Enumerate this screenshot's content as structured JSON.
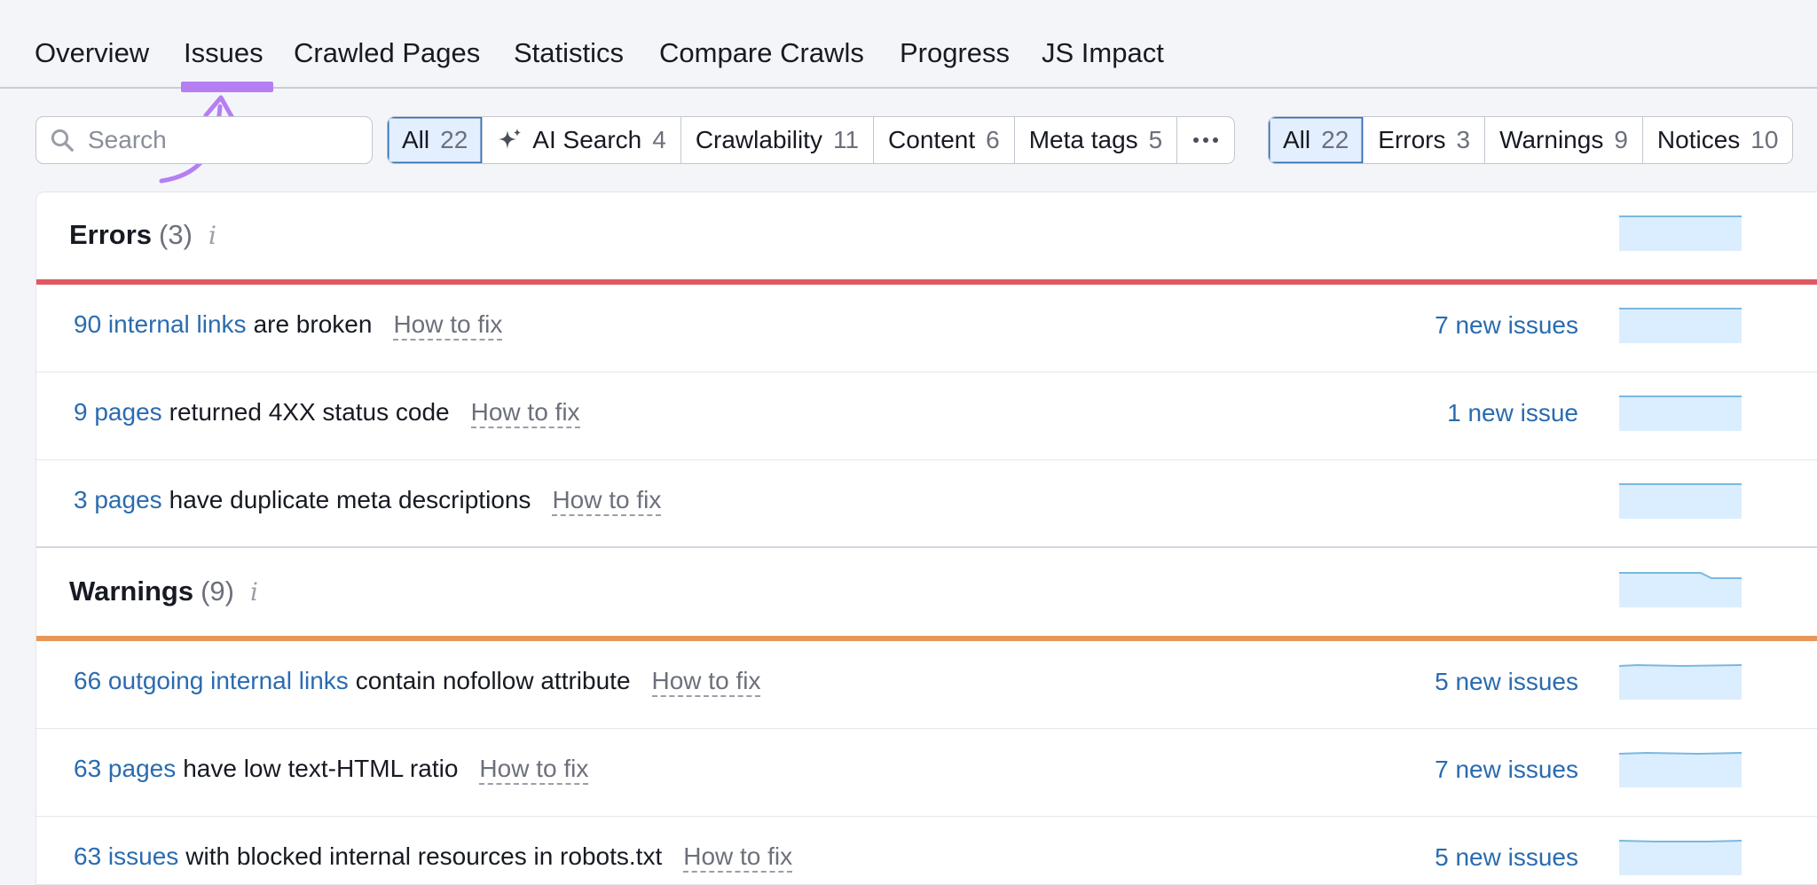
{
  "tabs": [
    {
      "label": "Overview"
    },
    {
      "label": "Issues"
    },
    {
      "label": "Crawled Pages"
    },
    {
      "label": "Statistics"
    },
    {
      "label": "Compare Crawls"
    },
    {
      "label": "Progress"
    },
    {
      "label": "JS Impact"
    }
  ],
  "active_tab": "Issues",
  "search": {
    "placeholder": "Search",
    "value": ""
  },
  "category_filters": [
    {
      "label": "All",
      "count": "22",
      "active": true
    },
    {
      "label": "AI Search",
      "count": "4",
      "icon": "sparkle-icon"
    },
    {
      "label": "Crawlability",
      "count": "11"
    },
    {
      "label": "Content",
      "count": "6"
    },
    {
      "label": "Meta tags",
      "count": "5"
    },
    {
      "label": "",
      "icon": "more-dots-icon"
    }
  ],
  "severity_filters": [
    {
      "label": "All",
      "count": "22",
      "active": true
    },
    {
      "label": "Errors",
      "count": "3"
    },
    {
      "label": "Warnings",
      "count": "9"
    },
    {
      "label": "Notices",
      "count": "10"
    }
  ],
  "colors": {
    "accent": "#2a6bb0",
    "tab_underline": "#b57ff2",
    "errors": "#dd5a62",
    "warnings": "#e8975a",
    "spark_fill": "#dbeeff",
    "spark_line": "#7ab8df"
  },
  "sections": {
    "errors": {
      "title": "Errors",
      "count": "(3)",
      "info": "i",
      "issues": [
        {
          "link": "90 internal links",
          "desc": "are broken",
          "fix": "How to fix",
          "new": "7 new issues"
        },
        {
          "link": "9 pages",
          "desc": "returned 4XX status code",
          "fix": "How to fix",
          "new": "1 new issue"
        },
        {
          "link": "3 pages",
          "desc": "have duplicate meta descriptions",
          "fix": "How to fix",
          "new": ""
        }
      ]
    },
    "warnings": {
      "title": "Warnings",
      "count": "(9)",
      "info": "i",
      "issues": [
        {
          "link": "66 outgoing internal links",
          "desc": "contain nofollow attribute",
          "fix": "How to fix",
          "new": "5 new issues"
        },
        {
          "link": "63 pages",
          "desc": "have low text-HTML ratio",
          "fix": "How to fix",
          "new": "7 new issues"
        },
        {
          "link": "63 issues",
          "desc": "with blocked internal resources in robots.txt",
          "fix": "How to fix",
          "new": "5 new issues"
        }
      ]
    }
  }
}
